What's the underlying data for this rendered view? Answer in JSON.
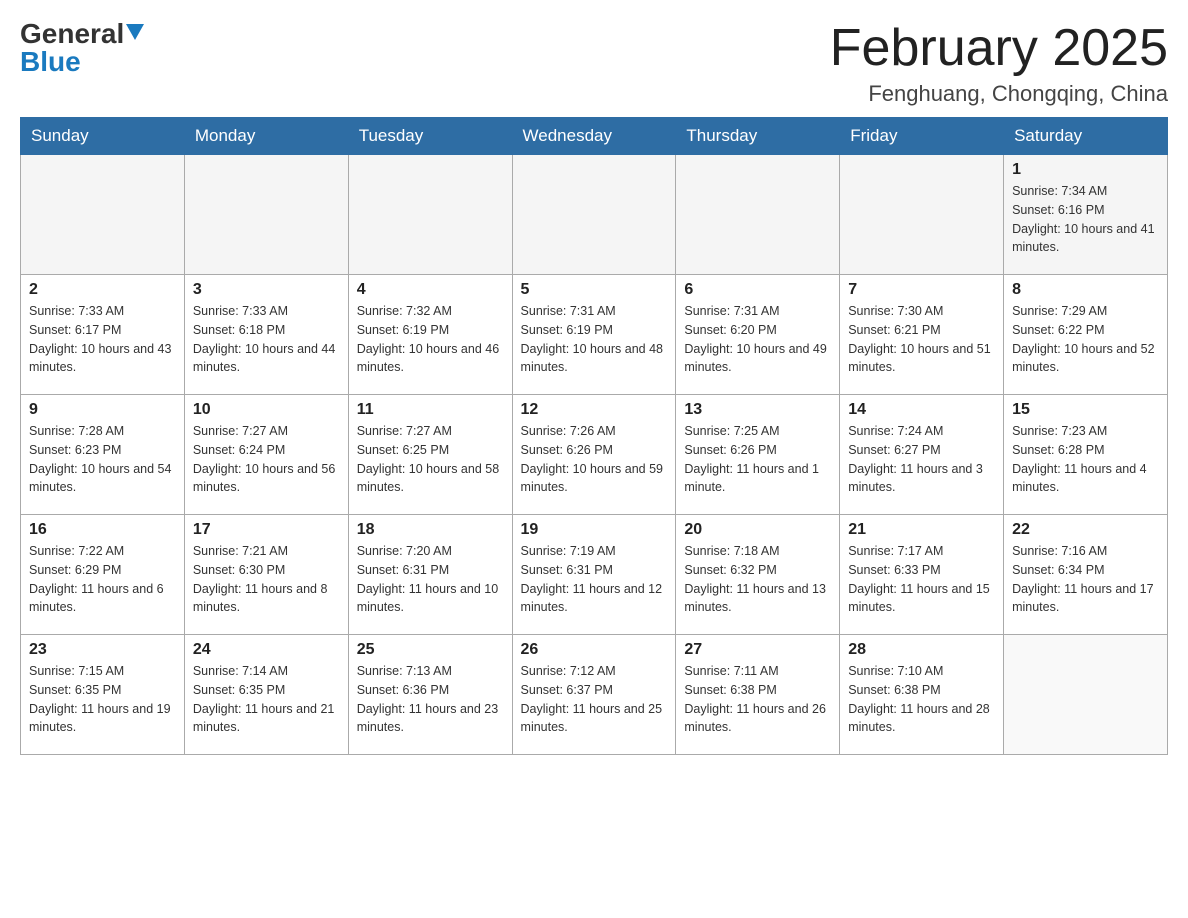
{
  "logo": {
    "general": "General",
    "blue": "Blue"
  },
  "header": {
    "title": "February 2025",
    "location": "Fenghuang, Chongqing, China"
  },
  "weekdays": [
    "Sunday",
    "Monday",
    "Tuesday",
    "Wednesday",
    "Thursday",
    "Friday",
    "Saturday"
  ],
  "weeks": [
    [
      {
        "day": "",
        "sunrise": "",
        "sunset": "",
        "daylight": ""
      },
      {
        "day": "",
        "sunrise": "",
        "sunset": "",
        "daylight": ""
      },
      {
        "day": "",
        "sunrise": "",
        "sunset": "",
        "daylight": ""
      },
      {
        "day": "",
        "sunrise": "",
        "sunset": "",
        "daylight": ""
      },
      {
        "day": "",
        "sunrise": "",
        "sunset": "",
        "daylight": ""
      },
      {
        "day": "",
        "sunrise": "",
        "sunset": "",
        "daylight": ""
      },
      {
        "day": "1",
        "sunrise": "Sunrise: 7:34 AM",
        "sunset": "Sunset: 6:16 PM",
        "daylight": "Daylight: 10 hours and 41 minutes."
      }
    ],
    [
      {
        "day": "2",
        "sunrise": "Sunrise: 7:33 AM",
        "sunset": "Sunset: 6:17 PM",
        "daylight": "Daylight: 10 hours and 43 minutes."
      },
      {
        "day": "3",
        "sunrise": "Sunrise: 7:33 AM",
        "sunset": "Sunset: 6:18 PM",
        "daylight": "Daylight: 10 hours and 44 minutes."
      },
      {
        "day": "4",
        "sunrise": "Sunrise: 7:32 AM",
        "sunset": "Sunset: 6:19 PM",
        "daylight": "Daylight: 10 hours and 46 minutes."
      },
      {
        "day": "5",
        "sunrise": "Sunrise: 7:31 AM",
        "sunset": "Sunset: 6:19 PM",
        "daylight": "Daylight: 10 hours and 48 minutes."
      },
      {
        "day": "6",
        "sunrise": "Sunrise: 7:31 AM",
        "sunset": "Sunset: 6:20 PM",
        "daylight": "Daylight: 10 hours and 49 minutes."
      },
      {
        "day": "7",
        "sunrise": "Sunrise: 7:30 AM",
        "sunset": "Sunset: 6:21 PM",
        "daylight": "Daylight: 10 hours and 51 minutes."
      },
      {
        "day": "8",
        "sunrise": "Sunrise: 7:29 AM",
        "sunset": "Sunset: 6:22 PM",
        "daylight": "Daylight: 10 hours and 52 minutes."
      }
    ],
    [
      {
        "day": "9",
        "sunrise": "Sunrise: 7:28 AM",
        "sunset": "Sunset: 6:23 PM",
        "daylight": "Daylight: 10 hours and 54 minutes."
      },
      {
        "day": "10",
        "sunrise": "Sunrise: 7:27 AM",
        "sunset": "Sunset: 6:24 PM",
        "daylight": "Daylight: 10 hours and 56 minutes."
      },
      {
        "day": "11",
        "sunrise": "Sunrise: 7:27 AM",
        "sunset": "Sunset: 6:25 PM",
        "daylight": "Daylight: 10 hours and 58 minutes."
      },
      {
        "day": "12",
        "sunrise": "Sunrise: 7:26 AM",
        "sunset": "Sunset: 6:26 PM",
        "daylight": "Daylight: 10 hours and 59 minutes."
      },
      {
        "day": "13",
        "sunrise": "Sunrise: 7:25 AM",
        "sunset": "Sunset: 6:26 PM",
        "daylight": "Daylight: 11 hours and 1 minute."
      },
      {
        "day": "14",
        "sunrise": "Sunrise: 7:24 AM",
        "sunset": "Sunset: 6:27 PM",
        "daylight": "Daylight: 11 hours and 3 minutes."
      },
      {
        "day": "15",
        "sunrise": "Sunrise: 7:23 AM",
        "sunset": "Sunset: 6:28 PM",
        "daylight": "Daylight: 11 hours and 4 minutes."
      }
    ],
    [
      {
        "day": "16",
        "sunrise": "Sunrise: 7:22 AM",
        "sunset": "Sunset: 6:29 PM",
        "daylight": "Daylight: 11 hours and 6 minutes."
      },
      {
        "day": "17",
        "sunrise": "Sunrise: 7:21 AM",
        "sunset": "Sunset: 6:30 PM",
        "daylight": "Daylight: 11 hours and 8 minutes."
      },
      {
        "day": "18",
        "sunrise": "Sunrise: 7:20 AM",
        "sunset": "Sunset: 6:31 PM",
        "daylight": "Daylight: 11 hours and 10 minutes."
      },
      {
        "day": "19",
        "sunrise": "Sunrise: 7:19 AM",
        "sunset": "Sunset: 6:31 PM",
        "daylight": "Daylight: 11 hours and 12 minutes."
      },
      {
        "day": "20",
        "sunrise": "Sunrise: 7:18 AM",
        "sunset": "Sunset: 6:32 PM",
        "daylight": "Daylight: 11 hours and 13 minutes."
      },
      {
        "day": "21",
        "sunrise": "Sunrise: 7:17 AM",
        "sunset": "Sunset: 6:33 PM",
        "daylight": "Daylight: 11 hours and 15 minutes."
      },
      {
        "day": "22",
        "sunrise": "Sunrise: 7:16 AM",
        "sunset": "Sunset: 6:34 PM",
        "daylight": "Daylight: 11 hours and 17 minutes."
      }
    ],
    [
      {
        "day": "23",
        "sunrise": "Sunrise: 7:15 AM",
        "sunset": "Sunset: 6:35 PM",
        "daylight": "Daylight: 11 hours and 19 minutes."
      },
      {
        "day": "24",
        "sunrise": "Sunrise: 7:14 AM",
        "sunset": "Sunset: 6:35 PM",
        "daylight": "Daylight: 11 hours and 21 minutes."
      },
      {
        "day": "25",
        "sunrise": "Sunrise: 7:13 AM",
        "sunset": "Sunset: 6:36 PM",
        "daylight": "Daylight: 11 hours and 23 minutes."
      },
      {
        "day": "26",
        "sunrise": "Sunrise: 7:12 AM",
        "sunset": "Sunset: 6:37 PM",
        "daylight": "Daylight: 11 hours and 25 minutes."
      },
      {
        "day": "27",
        "sunrise": "Sunrise: 7:11 AM",
        "sunset": "Sunset: 6:38 PM",
        "daylight": "Daylight: 11 hours and 26 minutes."
      },
      {
        "day": "28",
        "sunrise": "Sunrise: 7:10 AM",
        "sunset": "Sunset: 6:38 PM",
        "daylight": "Daylight: 11 hours and 28 minutes."
      },
      {
        "day": "",
        "sunrise": "",
        "sunset": "",
        "daylight": ""
      }
    ]
  ]
}
